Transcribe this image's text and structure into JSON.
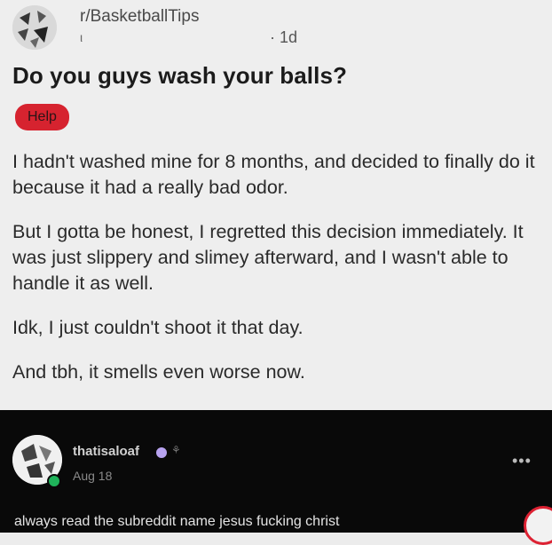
{
  "post": {
    "subreddit": "r/BasketballTips",
    "username": "ι",
    "age": "· 1d",
    "title": "Do you guys wash your balls?",
    "flair": "Help",
    "paragraphs": [
      "I hadn't washed mine for 8 months, and decided to finally do it because it had a really bad odor.",
      "But I gotta be honest, I regretted this decision immediately. It was just slippery and slimey afterward, and I wasn't able to handle it as well.",
      "Idk, I just couldn't shoot it that day.",
      "And tbh, it smells even worse now."
    ]
  },
  "comment": {
    "username": "thatisaloaf",
    "date": "Aug 18",
    "more": "•••",
    "text": "always read the subreddit name jesus fucking christ"
  },
  "colors": {
    "flair_bg": "#d6232f",
    "post_bg": "#eeeeee",
    "comment_bg": "#090909",
    "online": "#1fb35a"
  },
  "icons": [
    "subreddit-avatar-icon",
    "user-avatar-icon",
    "online-status-icon",
    "badge-icon",
    "more-options-icon"
  ]
}
